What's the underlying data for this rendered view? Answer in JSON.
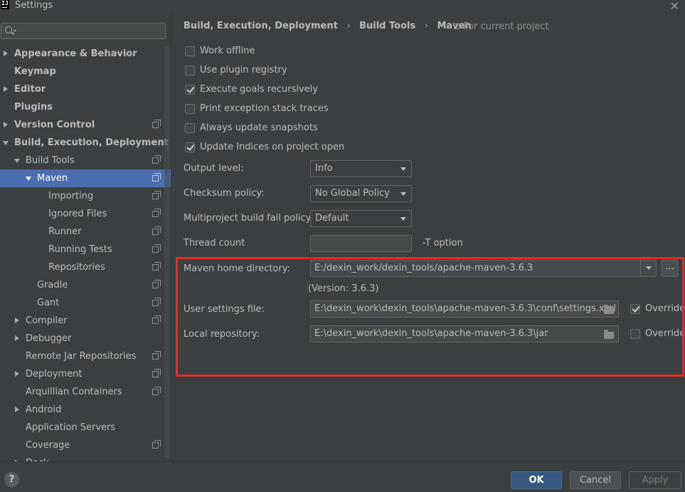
{
  "window": {
    "title": "Settings",
    "logo_text": "IJ"
  },
  "sidebar": {
    "items": [
      {
        "label": "Appearance & Behavior",
        "expanded": false,
        "has_arrow": true,
        "bold": true,
        "project": false
      },
      {
        "label": "Keymap",
        "has_arrow": false,
        "bold": true,
        "project": false
      },
      {
        "label": "Editor",
        "expanded": false,
        "has_arrow": true,
        "bold": true,
        "project": false
      },
      {
        "label": "Plugins",
        "has_arrow": false,
        "bold": true,
        "project": false
      },
      {
        "label": "Version Control",
        "expanded": false,
        "has_arrow": true,
        "bold": true,
        "project": true
      },
      {
        "label": "Build, Execution, Deployment",
        "expanded": true,
        "has_arrow": true,
        "bold": true,
        "project": false
      },
      {
        "label": "Build Tools",
        "expanded": true,
        "has_arrow": true,
        "bold": false,
        "project": true
      },
      {
        "label": "Maven",
        "expanded": true,
        "has_arrow": true,
        "bold": false,
        "project": true,
        "selected": true
      },
      {
        "label": "Importing",
        "has_arrow": false,
        "bold": false,
        "project": true
      },
      {
        "label": "Ignored Files",
        "has_arrow": false,
        "bold": false,
        "project": true
      },
      {
        "label": "Runner",
        "has_arrow": false,
        "bold": false,
        "project": true
      },
      {
        "label": "Running Tests",
        "has_arrow": false,
        "bold": false,
        "project": true
      },
      {
        "label": "Repositories",
        "has_arrow": false,
        "bold": false,
        "project": true
      },
      {
        "label": "Gradle",
        "has_arrow": false,
        "bold": false,
        "project": true
      },
      {
        "label": "Gant",
        "has_arrow": false,
        "bold": false,
        "project": true
      },
      {
        "label": "Compiler",
        "expanded": false,
        "has_arrow": true,
        "bold": false,
        "project": true
      },
      {
        "label": "Debugger",
        "expanded": false,
        "has_arrow": true,
        "bold": false,
        "project": false
      },
      {
        "label": "Remote Jar Repositories",
        "has_arrow": false,
        "bold": false,
        "project": true
      },
      {
        "label": "Deployment",
        "expanded": false,
        "has_arrow": true,
        "bold": false,
        "project": true
      },
      {
        "label": "Arquillian Containers",
        "has_arrow": false,
        "bold": false,
        "project": true
      },
      {
        "label": "Android",
        "expanded": false,
        "has_arrow": true,
        "bold": false,
        "project": false
      },
      {
        "label": "Application Servers",
        "has_arrow": false,
        "bold": false,
        "project": false
      },
      {
        "label": "Coverage",
        "has_arrow": false,
        "bold": false,
        "project": true
      },
      {
        "label": "Dock",
        "expanded": false,
        "has_arrow": true,
        "bold": false,
        "project": false
      }
    ]
  },
  "breadcrumb": {
    "parts": [
      "Build, Execution, Deployment",
      "Build Tools",
      "Maven"
    ],
    "separator": "›",
    "scope_label": "For current project"
  },
  "checkboxes": [
    {
      "label": "Work offline",
      "checked": false
    },
    {
      "label": "Use plugin registry",
      "checked": false
    },
    {
      "label": "Execute goals recursively",
      "checked": true
    },
    {
      "label": "Print exception stack traces",
      "checked": false
    },
    {
      "label": "Always update snapshots",
      "checked": false
    },
    {
      "label": "Update Indices on project open",
      "checked": true
    }
  ],
  "form": {
    "output_level": {
      "label": "Output level:",
      "value": "Info"
    },
    "checksum_policy": {
      "label": "Checksum policy:",
      "value": "No Global Policy"
    },
    "fail_policy": {
      "label": "Multiproject build fail policy:",
      "value": "Default"
    },
    "thread_count": {
      "label": "Thread count",
      "value": "",
      "hint": "-T option"
    },
    "maven_home": {
      "label": "Maven home directory:",
      "value": "E:/dexin_work/dexin_tools/apache-maven-3.6.3",
      "browse_label": "...",
      "version": "(Version: 3.6.3)"
    },
    "user_settings": {
      "label": "User settings file:",
      "value": "E:\\dexin_work\\dexin_tools\\apache-maven-3.6.3\\conf\\settings.xml",
      "override_label": "Override",
      "override_checked": true
    },
    "local_repo": {
      "label": "Local repository:",
      "value": "E:\\dexin_work\\dexin_tools\\apache-maven-3.6.3\\jar",
      "override_label": "Override",
      "override_checked": false
    }
  },
  "footer": {
    "help_label": "?",
    "ok_label": "OK",
    "cancel_label": "Cancel",
    "apply_label": "Apply"
  },
  "colors": {
    "background": "#3c3f41",
    "selection": "#4b6eaf",
    "highlight_border": "#e32d26",
    "ok_button": "#365880"
  }
}
